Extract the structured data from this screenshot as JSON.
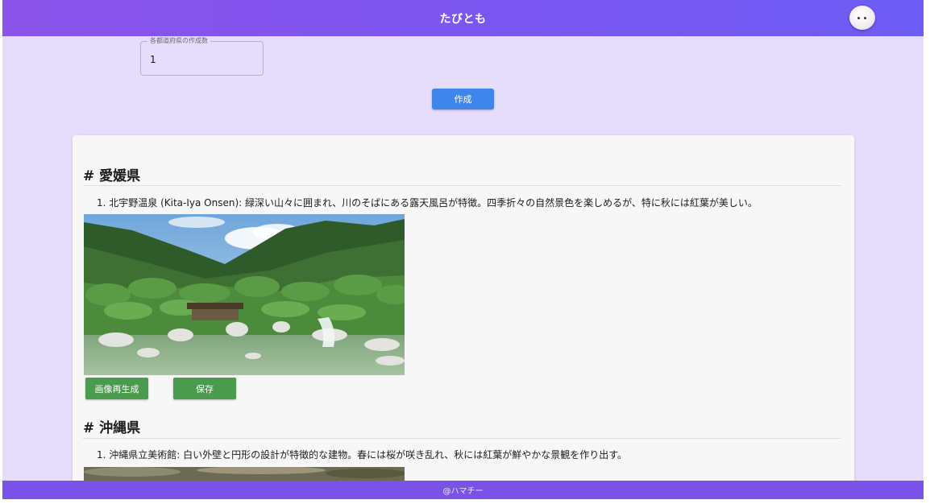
{
  "header": {
    "title": "たびとも"
  },
  "form": {
    "count_label": "各都道府県の作成数",
    "count_value": "1",
    "create_label": "作成"
  },
  "results": [
    {
      "heading": "# 愛媛県",
      "spots": [
        "1. 北宇野温泉 (Kita-Iya Onsen): 緑深い山々に囲まれ、川のそばにある露天風呂が特徴。四季折々の自然景色を楽しめるが、特に秋には紅葉が美しい。"
      ],
      "regenerate_label": "画像再生成",
      "save_label": "保存"
    },
    {
      "heading": "# 沖縄県",
      "spots": [
        "1. 沖縄県立美術館: 白い外壁と円形の設計が特徴的な建物。春には桜が咲き乱れ、秋には紅葉が鮮やかな景観を作り出す。"
      ]
    }
  ],
  "footer": {
    "credit": "@ハマチー"
  },
  "colors": {
    "header": "#8a53ea",
    "background": "#e6dcfb",
    "primary_button": "#3f86ec",
    "green_button": "#4a9b4e",
    "footer": "#7b52e8"
  }
}
